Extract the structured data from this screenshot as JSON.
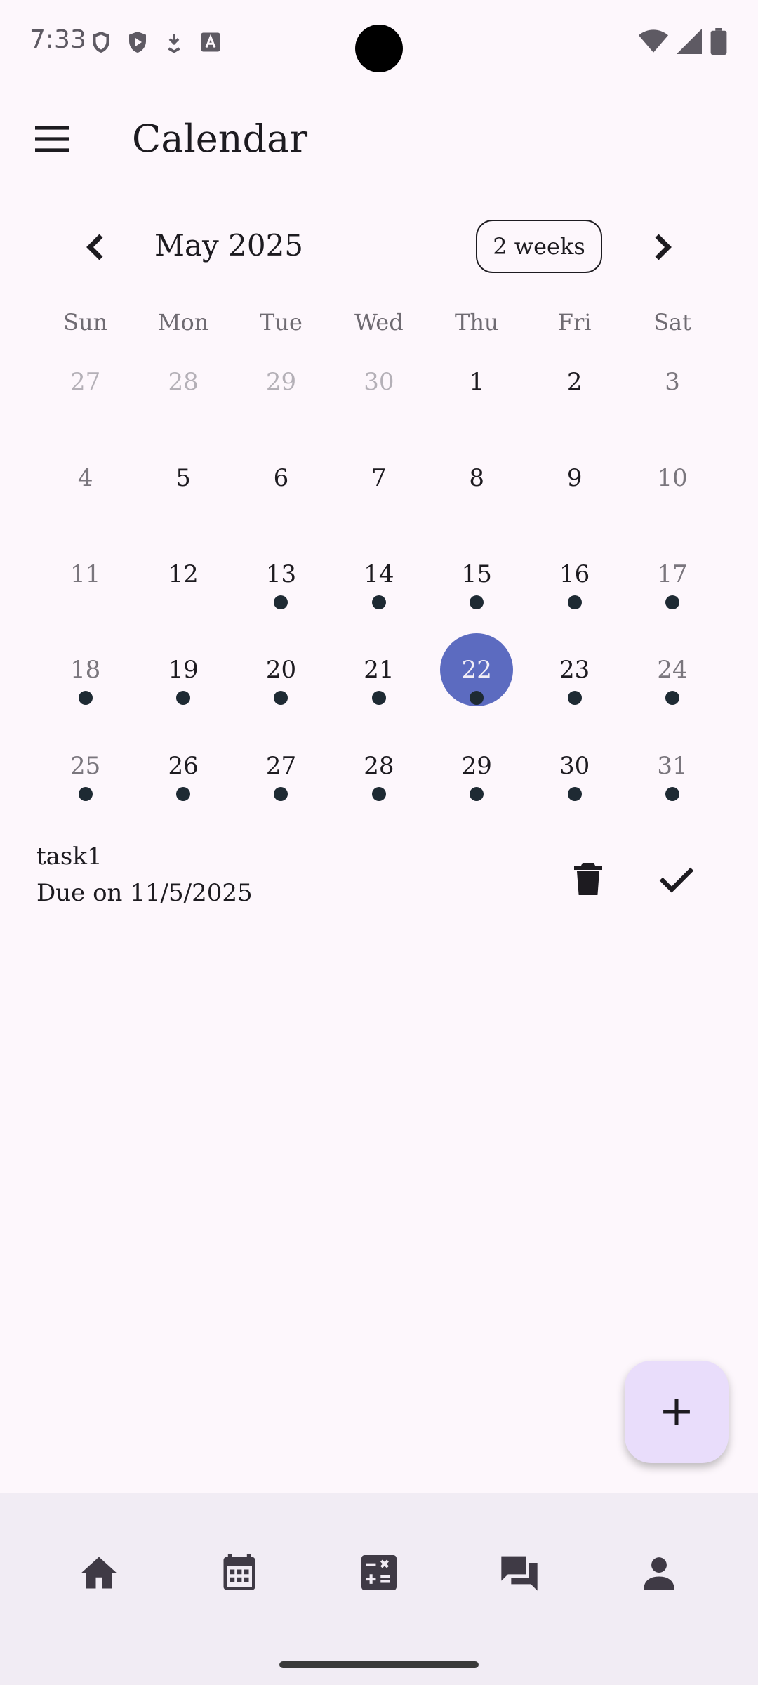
{
  "status": {
    "time": "7:33"
  },
  "app": {
    "title": "Calendar"
  },
  "calendar": {
    "month_label": "May 2025",
    "format_button": "2 weeks",
    "weekdays": [
      "Sun",
      "Mon",
      "Tue",
      "Wed",
      "Thu",
      "Fri",
      "Sat"
    ],
    "weeks": [
      [
        {
          "d": "27",
          "outside": true,
          "dot": false
        },
        {
          "d": "28",
          "outside": true,
          "dot": false
        },
        {
          "d": "29",
          "outside": true,
          "dot": false
        },
        {
          "d": "30",
          "outside": true,
          "dot": false
        },
        {
          "d": "1",
          "dot": false
        },
        {
          "d": "2",
          "dot": false
        },
        {
          "d": "3",
          "dot": false
        }
      ],
      [
        {
          "d": "4",
          "dot": false
        },
        {
          "d": "5",
          "dot": false
        },
        {
          "d": "6",
          "dot": false
        },
        {
          "d": "7",
          "dot": false
        },
        {
          "d": "8",
          "dot": false
        },
        {
          "d": "9",
          "dot": false
        },
        {
          "d": "10",
          "dot": false
        }
      ],
      [
        {
          "d": "11",
          "dot": false
        },
        {
          "d": "12",
          "dot": false
        },
        {
          "d": "13",
          "dot": true
        },
        {
          "d": "14",
          "dot": true
        },
        {
          "d": "15",
          "dot": true
        },
        {
          "d": "16",
          "dot": true
        },
        {
          "d": "17",
          "dot": true
        }
      ],
      [
        {
          "d": "18",
          "dot": true
        },
        {
          "d": "19",
          "dot": true
        },
        {
          "d": "20",
          "dot": true
        },
        {
          "d": "21",
          "dot": true
        },
        {
          "d": "22",
          "dot": true,
          "selected": true
        },
        {
          "d": "23",
          "dot": true
        },
        {
          "d": "24",
          "dot": true
        }
      ],
      [
        {
          "d": "25",
          "dot": true
        },
        {
          "d": "26",
          "dot": true
        },
        {
          "d": "27",
          "dot": true
        },
        {
          "d": "28",
          "dot": true
        },
        {
          "d": "29",
          "dot": true
        },
        {
          "d": "30",
          "dot": true
        },
        {
          "d": "31",
          "dot": true
        }
      ]
    ],
    "selected_color": "#5C6BC0"
  },
  "task": {
    "title": "task1",
    "due": "Due on 11/5/2025"
  },
  "icons": {
    "menu": "menu-icon",
    "prev": "chevron-left-icon",
    "next": "chevron-right-icon",
    "delete": "trash-icon",
    "complete": "check-icon",
    "add": "plus-icon",
    "nav": [
      "home-icon",
      "calendar-icon",
      "calculator-icon",
      "forum-icon",
      "person-icon"
    ]
  }
}
